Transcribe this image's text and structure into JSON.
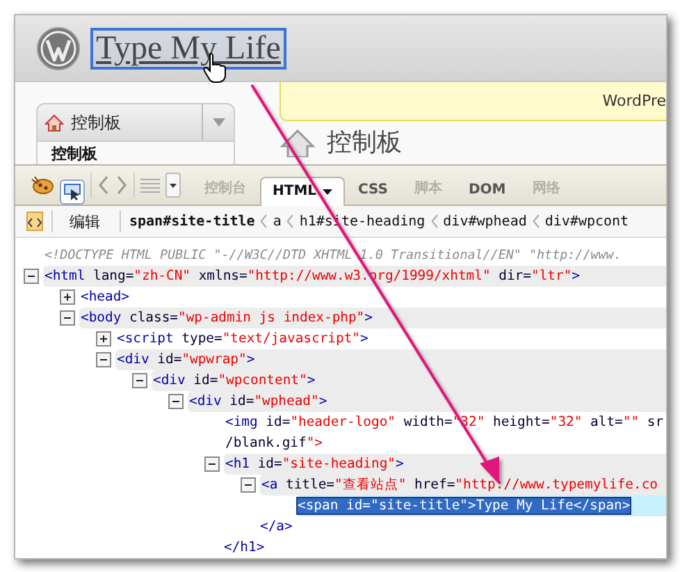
{
  "wp_header": {
    "site_title": "Type My Life",
    "inspect_highlighted": true
  },
  "admin_menu": {
    "menu_label": "控制板",
    "current_item": "控制板"
  },
  "notice": {
    "text": "WordPre"
  },
  "page_heading": "控制板",
  "firebug": {
    "toolbar": {
      "inspect_active": true,
      "tabs": [
        {
          "label": "控制台",
          "selected": false,
          "disabled": true,
          "has_menu": false
        },
        {
          "label": "HTML",
          "selected": true,
          "disabled": false,
          "has_menu": true
        },
        {
          "label": "CSS",
          "selected": false,
          "disabled": false,
          "has_menu": false
        },
        {
          "label": "脚本",
          "selected": false,
          "disabled": true,
          "has_menu": false
        },
        {
          "label": "DOM",
          "selected": false,
          "disabled": false,
          "has_menu": false
        },
        {
          "label": "网络",
          "selected": false,
          "disabled": true,
          "has_menu": false
        }
      ]
    },
    "breadcrumbs": {
      "edit_label": "编辑",
      "path": [
        {
          "label": "span#site-title",
          "selected": true
        },
        {
          "label": "a",
          "selected": false
        },
        {
          "label": "h1#site-heading",
          "selected": false
        },
        {
          "label": "div#wphead",
          "selected": false
        },
        {
          "label": "div#wpcont",
          "selected": false
        }
      ]
    },
    "tree": [
      {
        "kind": "comment",
        "selected": false,
        "lines": [
          "<!DOCTYPE HTML PUBLIC \"-//W3C//DTD XHTML 1.0 Transitional//EN\" \"http://www."
        ]
      },
      {
        "kind": "element",
        "expanded": true,
        "selected": false,
        "lines": [
          "<html lang=\"zh-CN\" xmlns=\"http://www.w3.org/1999/xhtml\" dir=\"ltr\">"
        ],
        "children": [
          {
            "kind": "element",
            "expanded": false,
            "selected": false,
            "lines": [
              "<head>"
            ]
          },
          {
            "kind": "element",
            "expanded": true,
            "selected": false,
            "lines": [
              "<body class=\"wp-admin js index-php\">"
            ],
            "children": [
              {
                "kind": "element",
                "expanded": false,
                "selected": false,
                "lines": [
                  "<script type=\"text/javascript\">"
                ]
              },
              {
                "kind": "element",
                "expanded": true,
                "selected": false,
                "lines": [
                  "<div id=\"wpwrap\">"
                ],
                "children": [
                  {
                    "kind": "element",
                    "expanded": true,
                    "selected": false,
                    "lines": [
                      "<div id=\"wpcontent\">"
                    ],
                    "children": [
                      {
                        "kind": "element",
                        "expanded": true,
                        "selected": false,
                        "lines": [
                          "<div id=\"wphead\">"
                        ],
                        "children": [
                          {
                            "kind": "leaf",
                            "selected": false,
                            "lines": [
                              "<img id=\"header-logo\" width=\"32\" height=\"32\" alt=\"\" sr",
                              "/blank.gif\">"
                            ]
                          },
                          {
                            "kind": "element",
                            "expanded": true,
                            "selected": false,
                            "lines": [
                              "<h1 id=\"site-heading\">"
                            ],
                            "closing": "</h1>",
                            "children": [
                              {
                                "kind": "element",
                                "expanded": true,
                                "selected": false,
                                "lines": [
                                  "<a title=\"查看站点\" href=\"http://www.typemylife.co"
                                ],
                                "closing": "</a>",
                                "children": [
                                  {
                                    "kind": "leaf",
                                    "selected": true,
                                    "lines": [
                                      "<span id=\"site-title\">Type My Life</span>"
                                    ]
                                  }
                                ]
                              }
                            ]
                          }
                        ]
                      }
                    ]
                  }
                ]
              }
            ]
          }
        ]
      }
    ]
  }
}
